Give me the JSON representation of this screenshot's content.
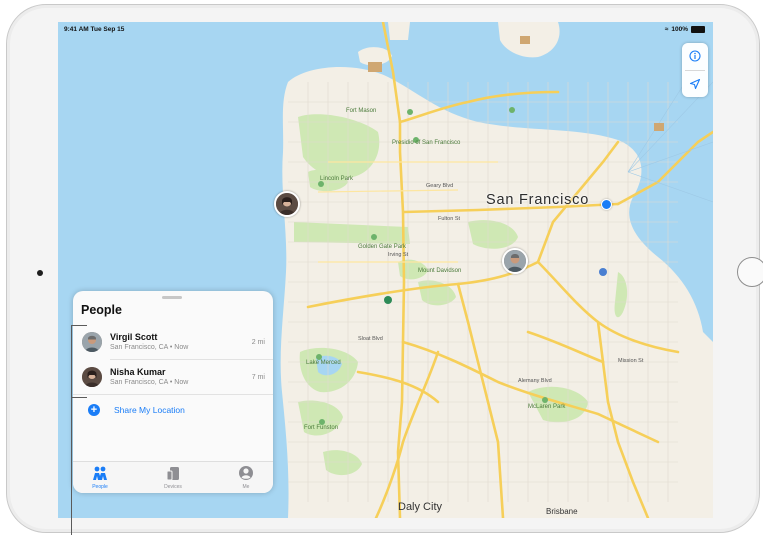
{
  "status_bar": {
    "time": "9:41 AM  Tue Sep 15",
    "battery": "100%"
  },
  "map": {
    "city_label": "San Francisco",
    "district_labels": [
      "Daly City",
      "Brisbane"
    ],
    "poi_labels": [
      "Fort Mason",
      "Presidio of San Francisco",
      "Lincoln Park",
      "Golden Gate Park",
      "Mount Davidson",
      "Lake Merced",
      "McLaren Park",
      "Fort Funston"
    ],
    "street_labels": [
      "Geary Blvd",
      "Fulton St",
      "Irving St",
      "Sloat Blvd",
      "Alemany Blvd",
      "Mission St"
    ]
  },
  "panel": {
    "title": "People",
    "people": [
      {
        "name": "Virgil Scott",
        "location": "San Francisco, CA • Now",
        "distance": "2 mi"
      },
      {
        "name": "Nisha Kumar",
        "location": "San Francisco, CA • Now",
        "distance": "7 mi"
      }
    ],
    "share_label": "Share My Location",
    "tabs": [
      {
        "label": "People",
        "icon": "people-icon",
        "active": true
      },
      {
        "label": "Devices",
        "icon": "devices-icon",
        "active": false
      },
      {
        "label": "Me",
        "icon": "me-icon",
        "active": false
      }
    ]
  },
  "colors": {
    "accent": "#1a7df7",
    "water": "#a7d6f2",
    "land": "#f3efe6",
    "park": "#cfe8b4",
    "road": "#f6cf59"
  }
}
